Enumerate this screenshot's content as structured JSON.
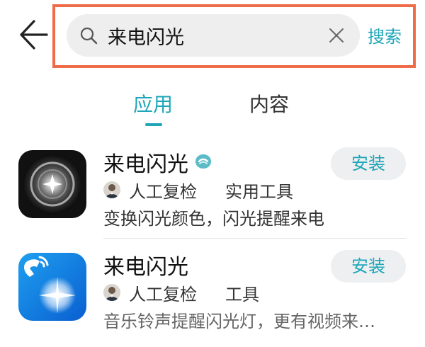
{
  "header": {
    "search": {
      "value": "来电闪光",
      "placeholder": ""
    },
    "search_button_label": "搜索",
    "icons": {
      "back": "back-arrow-icon",
      "search": "search-icon",
      "clear": "close-icon"
    }
  },
  "tabs": [
    {
      "label": "应用",
      "active": true
    },
    {
      "label": "内容",
      "active": false
    }
  ],
  "results": [
    {
      "name": "来电闪光",
      "verified": true,
      "reviewer": "人工复检",
      "category": "实用工具",
      "description": "变换闪光颜色，闪光提醒来电",
      "action_label": "安装",
      "icon": "flash-lens-app-icon"
    },
    {
      "name": "来电闪光",
      "verified": false,
      "reviewer": "人工复检",
      "category": "工具",
      "description": "音乐铃声提醒闪光灯，更有视频来…",
      "action_label": "安装",
      "icon": "phone-flash-app-icon"
    }
  ],
  "colors": {
    "accent": "#1fa6b8",
    "highlight_frame": "#ef6c48",
    "search_bg": "#eeeeef",
    "button_bg": "#eeeff1"
  }
}
